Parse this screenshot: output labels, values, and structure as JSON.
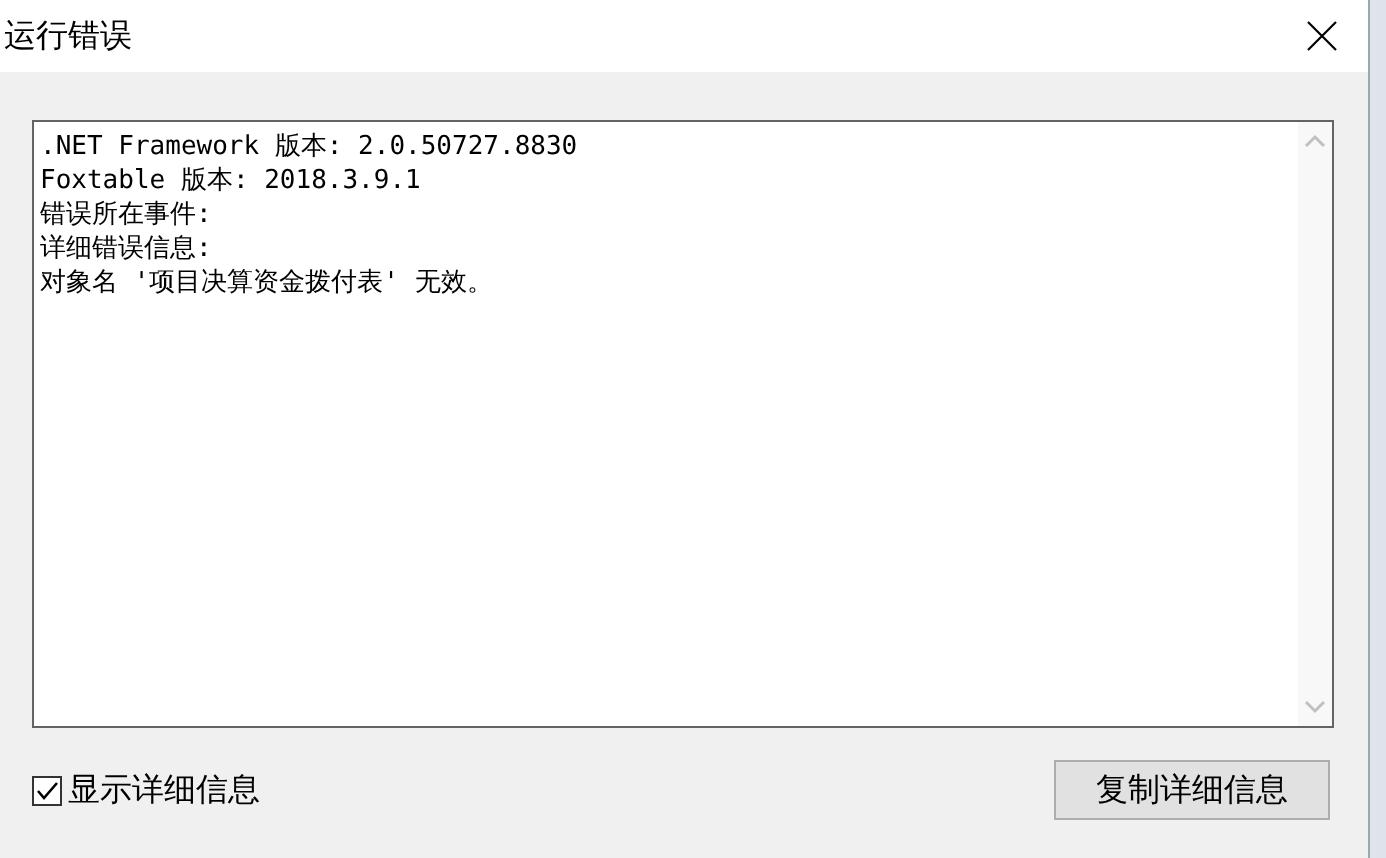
{
  "window": {
    "title": "运行错误"
  },
  "details": {
    "lines": [
      ".NET Framework 版本: 2.0.50727.8830",
      "Foxtable 版本: 2018.3.9.1",
      "错误所在事件:",
      "详细错误信息:",
      "对象名 '项目决算资金拨付表' 无效。"
    ]
  },
  "show_details": {
    "label": "显示详细信息",
    "checked": true
  },
  "buttons": [
    {
      "label": "复制详细信息"
    }
  ]
}
